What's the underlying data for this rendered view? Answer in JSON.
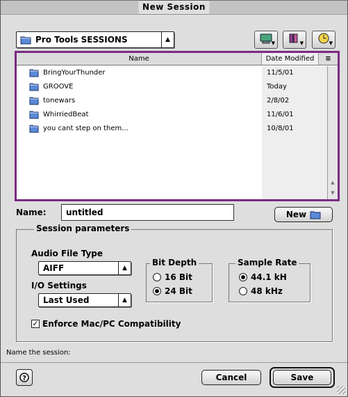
{
  "window": {
    "title": "New Session"
  },
  "location_popup": {
    "value": "Pro Tools SESSIONS"
  },
  "toolbar": {
    "icons": [
      "desktop-icon",
      "shortcuts-icon",
      "recent-icon"
    ]
  },
  "file_list": {
    "columns": [
      "Name",
      "Date Modified"
    ],
    "rows": [
      {
        "name": "BringYourThunder",
        "date": "11/5/01"
      },
      {
        "name": "GROOVE",
        "date": "Today"
      },
      {
        "name": "tonewars",
        "date": "2/8/02"
      },
      {
        "name": "WhirriedBeat",
        "date": "11/6/01"
      },
      {
        "name": "you cant step on them...",
        "date": "10/8/01"
      }
    ]
  },
  "name_field": {
    "label": "Name:",
    "value": "untitled"
  },
  "new_button": {
    "label": "New"
  },
  "session_parameters": {
    "title": "Session parameters",
    "audio_file_type": {
      "label": "Audio File Type",
      "value": "AIFF"
    },
    "io_settings": {
      "label": "I/O Settings",
      "value": "Last Used"
    },
    "bit_depth": {
      "title": "Bit Depth",
      "options": [
        "16 Bit",
        "24 Bit"
      ],
      "selected": "24 Bit"
    },
    "sample_rate": {
      "title": "Sample Rate",
      "options": [
        "44.1 kH",
        "48 kHz"
      ],
      "selected": "44.1 kH"
    },
    "compatibility": {
      "label": "Enforce Mac/PC Compatibility",
      "checked": true
    }
  },
  "status": {
    "text": "Name the session:"
  },
  "buttons": {
    "cancel": "Cancel",
    "save": "Save"
  },
  "colors": {
    "list_focus_border": "#7b2b83",
    "window_bg": "#dedede"
  }
}
